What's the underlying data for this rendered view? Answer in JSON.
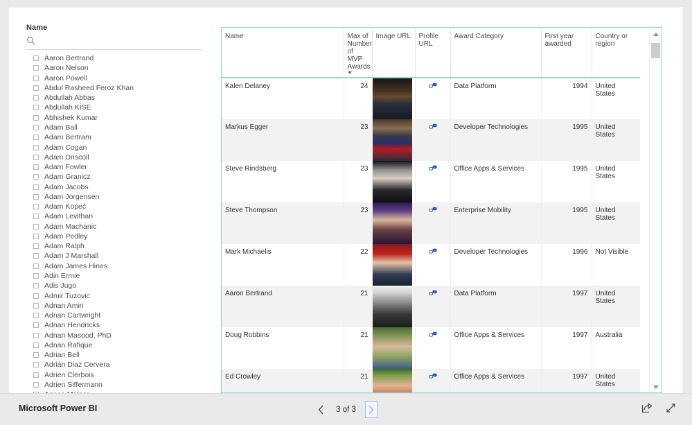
{
  "slicer": {
    "title": "Name",
    "search_placeholder": "",
    "search_value": "",
    "search_icon": "search-icon",
    "items": [
      {
        "label": "Aaron Bertrand",
        "checked": false
      },
      {
        "label": "Aaron Nelson",
        "checked": false
      },
      {
        "label": "Aaron Powell",
        "checked": false
      },
      {
        "label": "Abdul Rasheed Feroz Khan",
        "checked": false
      },
      {
        "label": "Abdullah Abbas",
        "checked": false
      },
      {
        "label": "Abdullah KİSE",
        "checked": false
      },
      {
        "label": "Abhishek Kumar",
        "checked": false
      },
      {
        "label": "Adam Ball",
        "checked": false
      },
      {
        "label": "Adam Bertram",
        "checked": false
      },
      {
        "label": "Adam Cogan",
        "checked": false
      },
      {
        "label": "Adam Driscoll",
        "checked": false
      },
      {
        "label": "Adam Fowler",
        "checked": false
      },
      {
        "label": "Adam Granicz",
        "checked": false
      },
      {
        "label": "Adam Jacobs",
        "checked": false
      },
      {
        "label": "Adam Jorgensen",
        "checked": false
      },
      {
        "label": "Adam Kopeć",
        "checked": false
      },
      {
        "label": "Adam Levithan",
        "checked": false
      },
      {
        "label": "Adam Machanic",
        "checked": false
      },
      {
        "label": "Adam Pedley",
        "checked": false
      },
      {
        "label": "Adam Ralph",
        "checked": false
      },
      {
        "label": "Adam J Marshall",
        "checked": false
      },
      {
        "label": "Adam James Hines",
        "checked": false
      },
      {
        "label": "Adin Ermie",
        "checked": false
      },
      {
        "label": "Adis Jugo",
        "checked": false
      },
      {
        "label": "Admir Tuzovic",
        "checked": false
      },
      {
        "label": "Adnan Amin",
        "checked": false
      },
      {
        "label": "Adnan Cartwright",
        "checked": false
      },
      {
        "label": "Adnan Hendricks",
        "checked": false
      },
      {
        "label": "Adnan Masood, PhD",
        "checked": false
      },
      {
        "label": "Adnan Rafique",
        "checked": false
      },
      {
        "label": "Adrian Bell",
        "checked": false
      },
      {
        "label": "Adrián Diaz Cervera",
        "checked": false
      },
      {
        "label": "Adrien Clerbois",
        "checked": false
      },
      {
        "label": "Adrien Siffermann",
        "checked": false
      },
      {
        "label": "Agnes Molnar",
        "checked": false
      }
    ]
  },
  "table": {
    "columns": [
      {
        "label": "Name",
        "align": "left"
      },
      {
        "label": "Max of Number of MVP Awards",
        "align": "right",
        "sorted": "desc",
        "sort_icon": "sort-descending-icon"
      },
      {
        "label": "Image URL",
        "align": "left"
      },
      {
        "label": "Profile URL",
        "align": "left"
      },
      {
        "label": "Award Category",
        "align": "left"
      },
      {
        "label": "First year awarded",
        "align": "right"
      },
      {
        "label": "Country or region",
        "align": "left"
      }
    ],
    "link_icon": "link-icon",
    "rows": [
      {
        "name": "Kalen Delaney",
        "awards": "24",
        "profile": "link-icon",
        "category": "Data Platform",
        "first_year": "1994",
        "country": "United States"
      },
      {
        "name": "Markus Egger",
        "awards": "23",
        "profile": "link-icon",
        "category": "Developer Technologies",
        "first_year": "1995",
        "country": "United States"
      },
      {
        "name": "Steve Rindsberg",
        "awards": "23",
        "profile": "link-icon",
        "category": "Office Apps & Services",
        "first_year": "1995",
        "country": "United States"
      },
      {
        "name": "Steve Thompson",
        "awards": "23",
        "profile": "link-icon",
        "category": "Enterprise Mobility",
        "first_year": "1995",
        "country": "United States"
      },
      {
        "name": "Mark Michaelis",
        "awards": "22",
        "profile": "link-icon",
        "category": "Developer Technologies",
        "first_year": "1996",
        "country": "Not Visible"
      },
      {
        "name": "Aaron Bertrand",
        "awards": "21",
        "profile": "link-icon",
        "category": "Data Platform",
        "first_year": "1997",
        "country": "United States"
      },
      {
        "name": "Doug Robbins",
        "awards": "21",
        "profile": "link-icon",
        "category": "Office Apps & Services",
        "first_year": "1997",
        "country": "Australia"
      },
      {
        "name": "Ed Crowley",
        "awards": "21",
        "profile": "link-icon",
        "category": "Office Apps & Services",
        "first_year": "1997",
        "country": "United States"
      }
    ],
    "accent_color": "#8ad8d8",
    "scrollbar": {
      "up_icon": "chevron-up-icon",
      "down_icon": "chevron-down-icon"
    }
  },
  "footer": {
    "brand": "Microsoft Power BI",
    "prev_icon": "chevron-left-icon",
    "next_icon": "chevron-right-icon",
    "page_label": "3 of 3",
    "share_icon": "share-icon",
    "fullscreen_icon": "fullscreen-icon"
  }
}
